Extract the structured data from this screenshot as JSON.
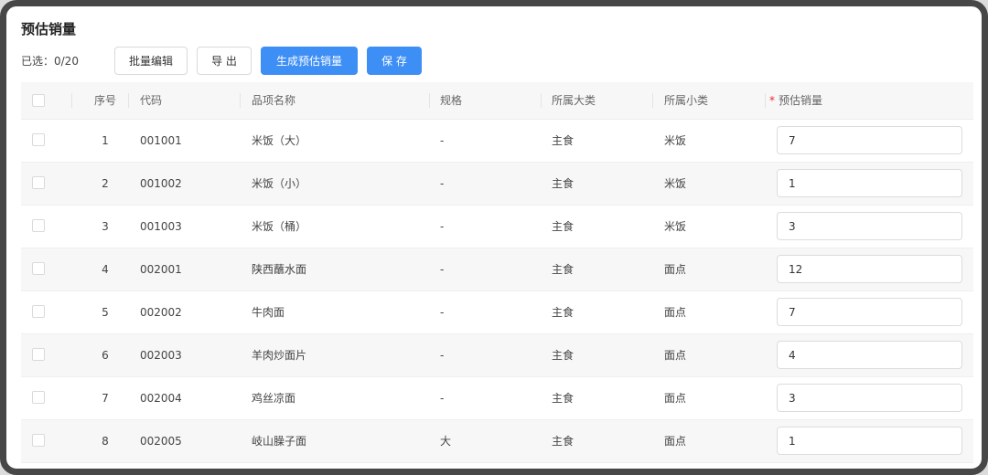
{
  "page": {
    "title": "预估销量",
    "selected_count": "已选：0/20"
  },
  "toolbar": {
    "batch_edit_label": "批量编辑",
    "export_label": "导 出",
    "generate_label": "生成预估销量",
    "save_label": "保 存"
  },
  "table": {
    "headers": {
      "seq": "序号",
      "code": "代码",
      "name": "品项名称",
      "spec": "规格",
      "major": "所属大类",
      "minor": "所属小类",
      "required_mark": "*",
      "forecast": "预估销量"
    },
    "rows": [
      {
        "seq": "1",
        "code": "001001",
        "name": "米饭（大）",
        "spec": "-",
        "major": "主食",
        "minor": "米饭",
        "forecast": "7"
      },
      {
        "seq": "2",
        "code": "001002",
        "name": "米饭（小）",
        "spec": "-",
        "major": "主食",
        "minor": "米饭",
        "forecast": "1"
      },
      {
        "seq": "3",
        "code": "001003",
        "name": "米饭（桶）",
        "spec": "-",
        "major": "主食",
        "minor": "米饭",
        "forecast": "3"
      },
      {
        "seq": "4",
        "code": "002001",
        "name": "陕西蘸水面",
        "spec": "-",
        "major": "主食",
        "minor": "面点",
        "forecast": "12"
      },
      {
        "seq": "5",
        "code": "002002",
        "name": "牛肉面",
        "spec": "-",
        "major": "主食",
        "minor": "面点",
        "forecast": "7"
      },
      {
        "seq": "6",
        "code": "002003",
        "name": "羊肉炒面片",
        "spec": "-",
        "major": "主食",
        "minor": "面点",
        "forecast": "4"
      },
      {
        "seq": "7",
        "code": "002004",
        "name": "鸡丝凉面",
        "spec": "-",
        "major": "主食",
        "minor": "面点",
        "forecast": "3"
      },
      {
        "seq": "8",
        "code": "002005",
        "name": "岐山臊子面",
        "spec": "大",
        "major": "主食",
        "minor": "面点",
        "forecast": "1"
      }
    ]
  }
}
